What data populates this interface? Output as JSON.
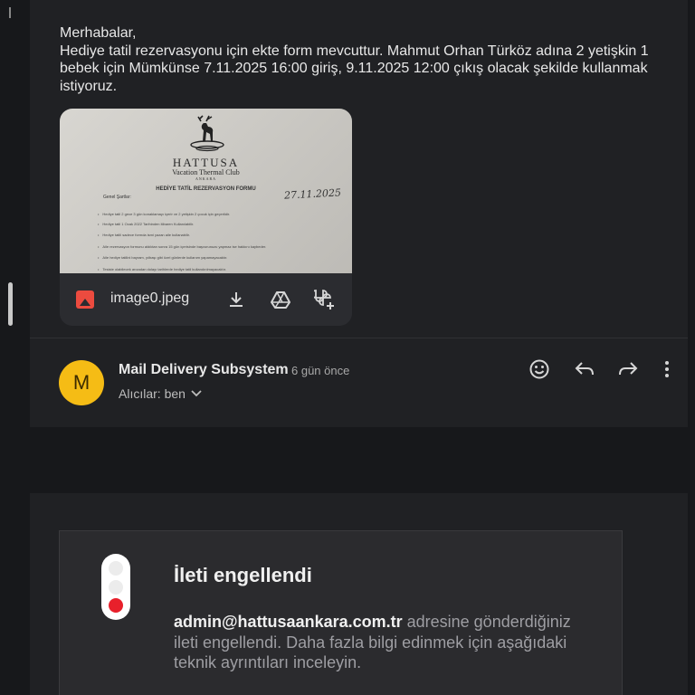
{
  "message": {
    "greeting": "Merhabalar,",
    "body": "Hediye tatil rezervasyonu için ekte form mevcuttur. Mahmut Orhan Türköz adına 2 yetişkin 1 bebek için Mümkünse 7.11.2025 16:00 giriş, 9.11.2025 12:00 çıkış olacak şekilde kullanmak istiyoruz."
  },
  "attachment": {
    "file_name": "image0.jpeg",
    "icon": "image-icon",
    "actions": [
      "download-icon",
      "drive-icon",
      "photos-add-icon"
    ],
    "preview": {
      "brand": "HATTUSA",
      "brand_sub": "Vacation Thermal Club",
      "brand_city": "ANKARA",
      "heading": "HEDİYE TATİL REZERVASYON FORMU",
      "signed_date": "27.11.2025",
      "section": "Genel Şartlar:",
      "lines": [
        "Hediye tatil 2 gece 3 gün konaklamayı içerir ve 2 yetişkin 2 çocuk için geçerlidir.",
        "Hediye tatil 1 Ocak 2022 Tarihinden itibaren Kullanılabilir.",
        "Hediye tatili sadece formda ismi yazan aile kullanabilir.",
        "Aile rezervasyon formunu aldıktan sonra 15 gün içerisinde başvurunuzu yapmaz ise hakkını kaybeder.",
        "Aile hediye tatilini bayram, yılbaşı gibi özel günlerde kullanım yapamayacaktır.",
        "Tesiste olabilecek arızadan dolayı tarihlerde hediye tatil kullandırılmayacaktır."
      ]
    }
  },
  "reply": {
    "avatar_letter": "M",
    "sender": "Mail Delivery Subsystem",
    "time": "6 gün önce",
    "recipients": "Alıcılar: ben",
    "actions": [
      "emoji-icon",
      "reply-icon",
      "forward-icon",
      "more-icon"
    ]
  },
  "blocked": {
    "title": "İleti engellendi",
    "email": "admin@hattusaankara.com.tr",
    "text": " adresine gönderdiğiniz ileti engellendi. Daha fazla bilgi edinmek için aşağıdaki teknik ayrıntıları inceleyin."
  },
  "colors": {
    "background": "#17181b",
    "card": "#202124",
    "avatar": "#f5bc15",
    "traffic_red": "#e8202b"
  }
}
